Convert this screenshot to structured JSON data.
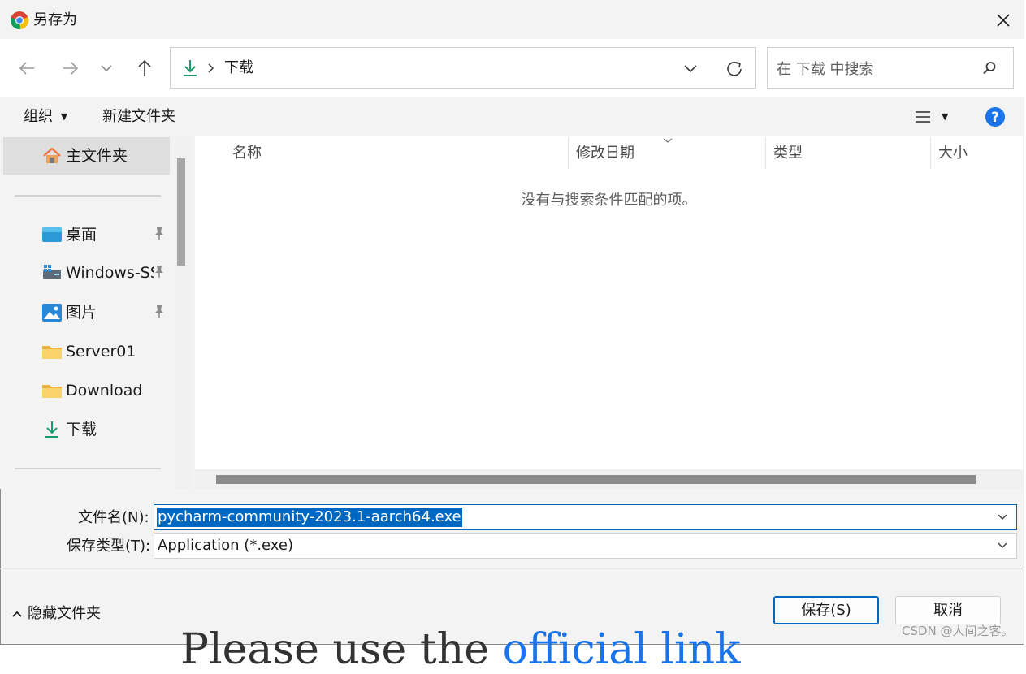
{
  "window": {
    "title": "另存为"
  },
  "nav": {
    "address_segment": "下载",
    "search_placeholder": "在 下载 中搜索"
  },
  "toolbar": {
    "organize_label": "组织",
    "new_folder_label": "新建文件夹"
  },
  "sidebar": {
    "home_label": "主文件夹",
    "items": [
      {
        "label": "桌面",
        "icon": "desktop-icon",
        "pinned": true
      },
      {
        "label": "Windows-SSD",
        "icon": "windows-icon",
        "pinned": true
      },
      {
        "label": "图片",
        "icon": "pictures-icon",
        "pinned": true
      },
      {
        "label": "Server01",
        "icon": "folder-icon",
        "pinned": false
      },
      {
        "label": "Download",
        "icon": "folder-icon",
        "pinned": false
      },
      {
        "label": "下载",
        "icon": "download-icon",
        "pinned": false
      }
    ]
  },
  "columns": {
    "name": "名称",
    "modified": "修改日期",
    "type": "类型",
    "size": "大小"
  },
  "content": {
    "empty_message": "没有与搜索条件匹配的项。"
  },
  "form": {
    "filename_label": "文件名(N):",
    "filename_value": "pycharm-community-2023.1-aarch64.exe",
    "filetype_label": "保存类型(T):",
    "filetype_value": "Application (*.exe)"
  },
  "footer": {
    "hide_folders_label": "隐藏文件夹",
    "save_label": "保存(S)",
    "cancel_label": "取消"
  },
  "background": {
    "text_prefix": "Please use the",
    "text_link": "official link"
  },
  "watermark": "CSDN @人间之客。",
  "colors": {
    "accent": "#0067c0",
    "download_green": "#1a9a6a",
    "help_blue": "#1a73e8"
  }
}
